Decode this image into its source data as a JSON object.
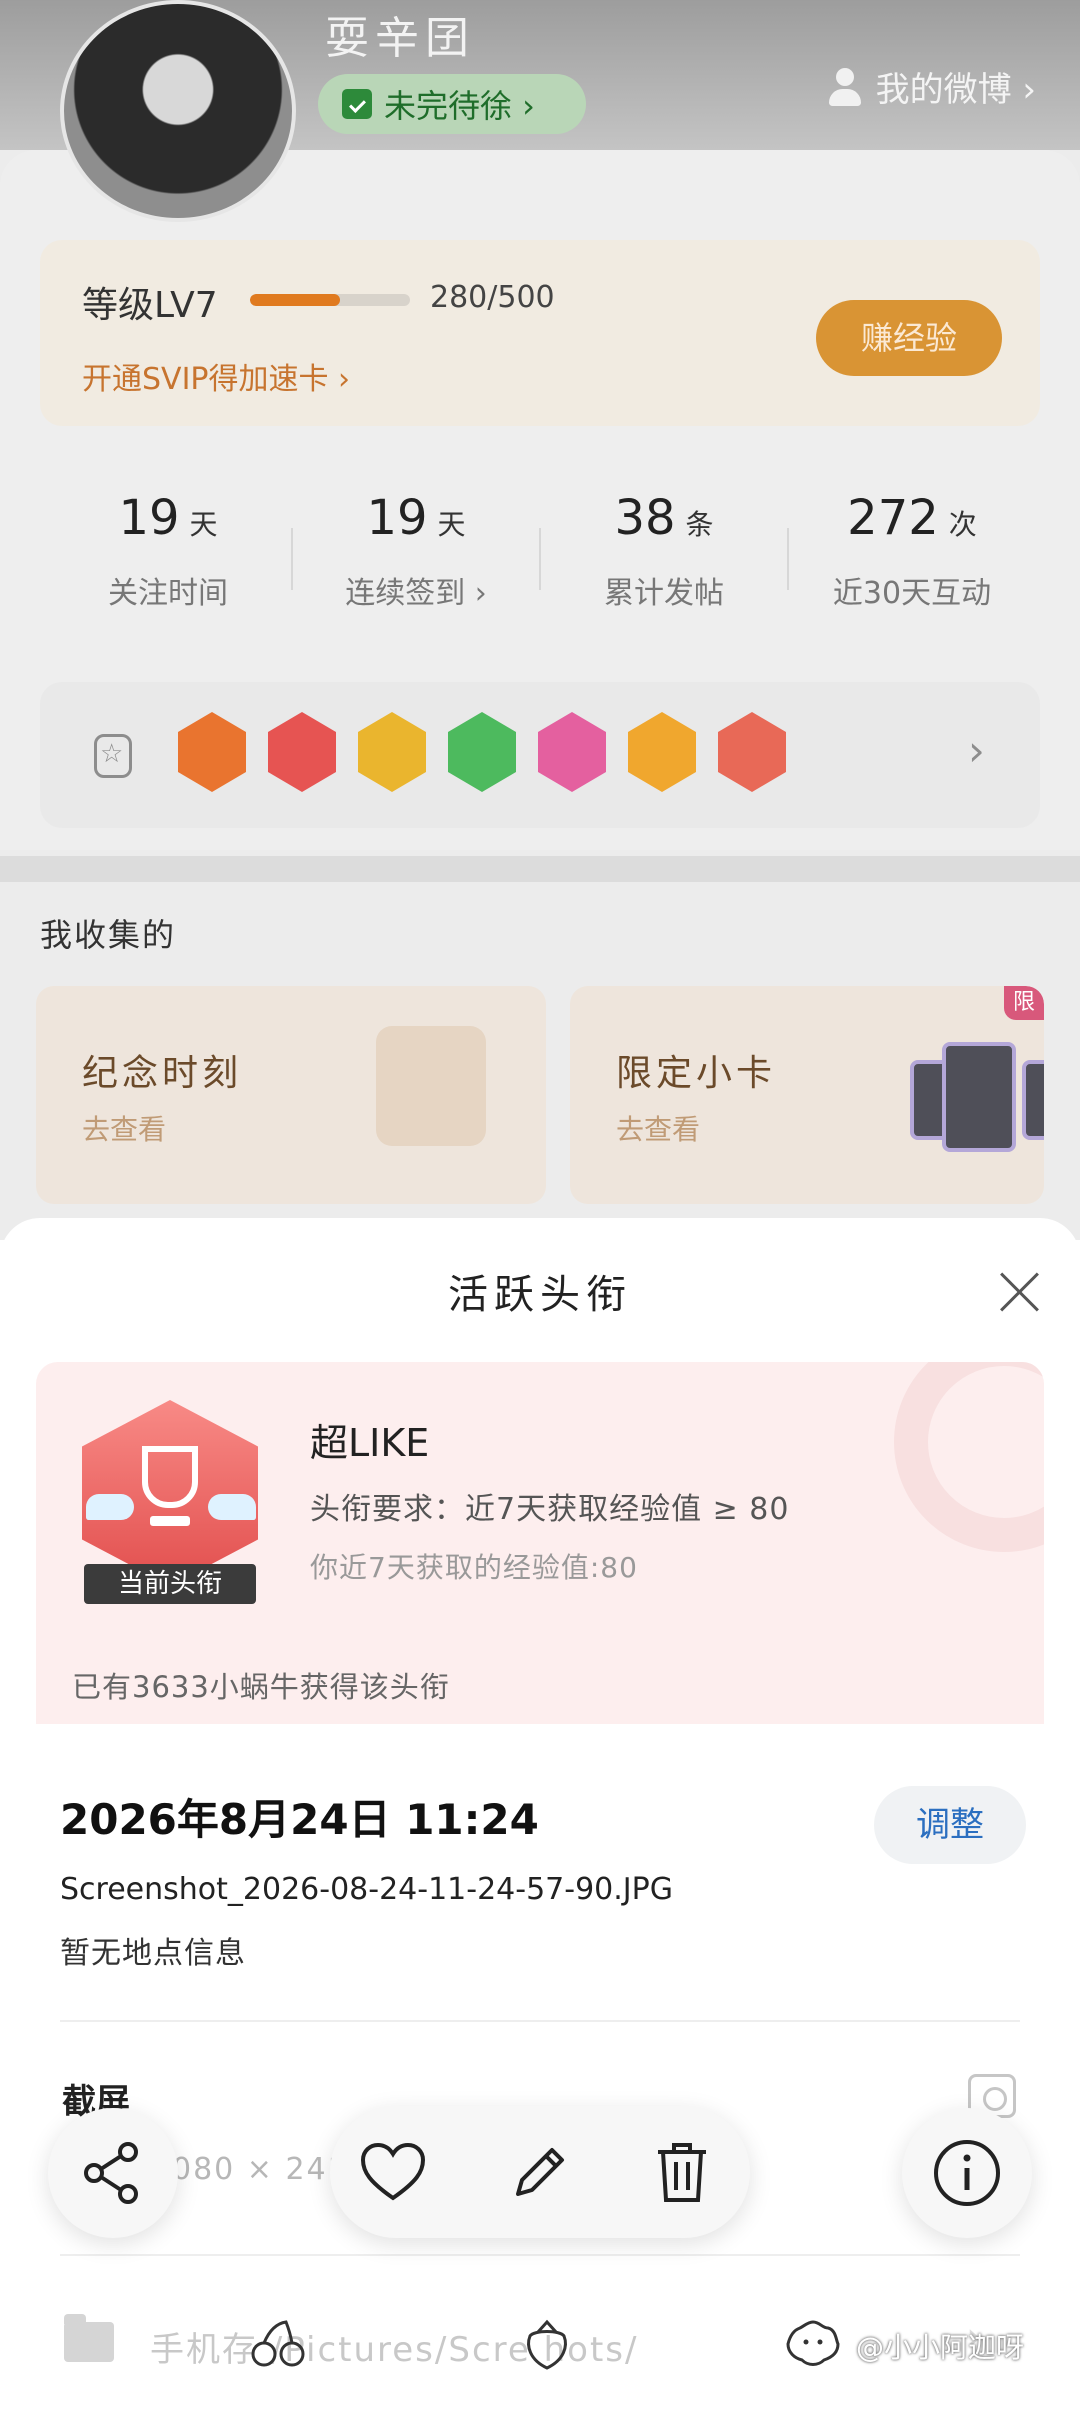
{
  "profile": {
    "username": "耍辛囝",
    "todo_label": "未完待徐 ›",
    "weibo_link": "我的微博 ›"
  },
  "level": {
    "label": "等级LV7",
    "progress_current": 280,
    "progress_max": 500,
    "progress_text": "280/500",
    "svip_link": "开通SVIP得加速卡 ›",
    "earn_button": "赚经验"
  },
  "stats": [
    {
      "value": "19",
      "unit": "天",
      "label": "关注时间"
    },
    {
      "value": "19",
      "unit": "天",
      "label": "连续签到 ›"
    },
    {
      "value": "38",
      "unit": "条",
      "label": "累计发帖"
    },
    {
      "value": "272",
      "unit": "次",
      "label": "近30天互动"
    }
  ],
  "medals": {
    "chevron": "›"
  },
  "collections": {
    "title": "我收集的",
    "items": [
      {
        "title": "纪念时刻",
        "subtitle": "去查看"
      },
      {
        "title": "限定小卡",
        "subtitle": "去查看",
        "tag": "限"
      }
    ]
  },
  "sheet": {
    "title": "活跃头衔",
    "badge_label": "当前头衔",
    "title_name": "超LIKE",
    "requirement": "头衔要求：近7天获取经验值 ≥ 80",
    "my_value": "你近7天获取的经验值:80",
    "holders": "已有3633小蜗牛获得该头衔"
  },
  "photo_info": {
    "datetime": "2026年8月24日  11:24",
    "adjust_button": "调整",
    "filename": "Screenshot_2026-08-24-11-24-57-90.JPG",
    "location": "暂无地点信息",
    "category": "截屏",
    "dimensions": "080 × 241",
    "path": "手机存 /Pictures/Scre  hots/",
    "path_chevron": "›"
  },
  "watermark": "@小小阿迦呀",
  "colors": {
    "accent_orange": "#e07a1f",
    "adjust_blue": "#2b6fc0",
    "sheet_card_pink": "#fdeeee"
  }
}
